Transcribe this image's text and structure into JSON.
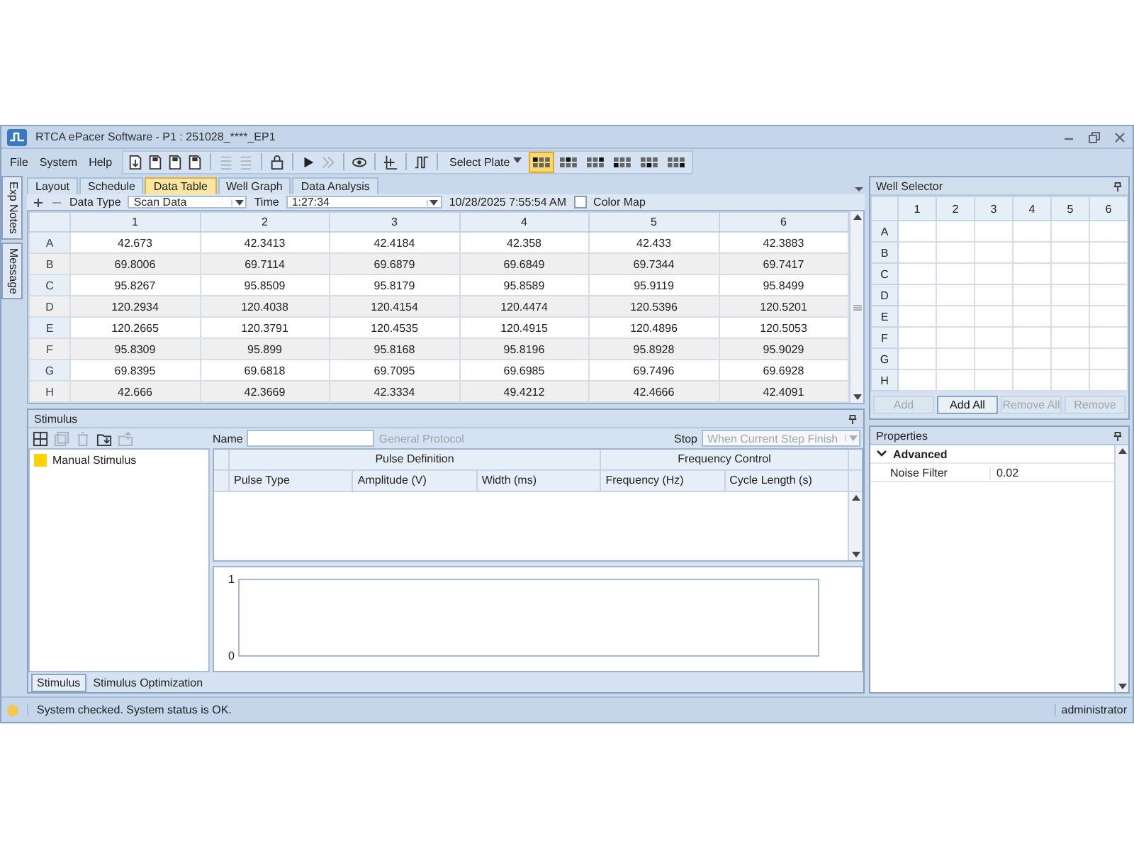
{
  "window": {
    "title": "RTCA ePacer Software - P1 : 251028_****_EP1"
  },
  "menu": [
    "File",
    "System",
    "Help"
  ],
  "toolbar": {
    "buttons": [
      {
        "disabled": false
      },
      {
        "disabled": false
      },
      {
        "disabled": false
      },
      {
        "disabled": false
      },
      {
        "disabled": true
      },
      {
        "disabled": true
      },
      {
        "disabled": false
      },
      {
        "disabled": false
      },
      {
        "disabled": true
      },
      {
        "disabled": false
      },
      {
        "disabled": false
      },
      {
        "disabled": false
      }
    ],
    "select_plate": "Select Plate",
    "layouts": [
      {
        "selected": true
      },
      {
        "selected": false
      },
      {
        "selected": false
      },
      {
        "selected": false
      },
      {
        "selected": false
      },
      {
        "selected": false
      }
    ]
  },
  "side_tabs": [
    "Exp Notes",
    "Message"
  ],
  "view_tabs": [
    {
      "label": "Layout",
      "selected": false
    },
    {
      "label": "Schedule",
      "selected": false
    },
    {
      "label": "Data Table",
      "selected": true
    },
    {
      "label": "Well Graph",
      "selected": false
    },
    {
      "label": "Data Analysis",
      "selected": false
    }
  ],
  "filters": {
    "data_type_label": "Data Type",
    "data_type": "Scan Data",
    "time_label": "Time",
    "time": "1:27:34",
    "timestamp": "10/28/2025 7:55:54 AM",
    "color_map": {
      "label": "Color Map",
      "checked": false
    }
  },
  "table": {
    "columns": [
      "1",
      "2",
      "3",
      "4",
      "5",
      "6"
    ],
    "rows": [
      {
        "label": "A",
        "cells": [
          "42.673",
          "42.3413",
          "42.4184",
          "42.358",
          "42.433",
          "42.3883"
        ]
      },
      {
        "label": "B",
        "cells": [
          "69.8006",
          "69.7114",
          "69.6879",
          "69.6849",
          "69.7344",
          "69.7417"
        ]
      },
      {
        "label": "C",
        "cells": [
          "95.8267",
          "95.8509",
          "95.8179",
          "95.8589",
          "95.9119",
          "95.8499"
        ]
      },
      {
        "label": "D",
        "cells": [
          "120.2934",
          "120.4038",
          "120.4154",
          "120.4474",
          "120.5396",
          "120.5201"
        ]
      },
      {
        "label": "E",
        "cells": [
          "120.2665",
          "120.3791",
          "120.4535",
          "120.4915",
          "120.4896",
          "120.5053"
        ]
      },
      {
        "label": "F",
        "cells": [
          "95.8309",
          "95.899",
          "95.8168",
          "95.8196",
          "95.8928",
          "95.9029"
        ]
      },
      {
        "label": "G",
        "cells": [
          "69.8395",
          "69.6818",
          "69.7095",
          "69.6985",
          "69.7496",
          "69.6928"
        ]
      },
      {
        "label": "H",
        "cells": [
          "42.666",
          "42.3669",
          "42.3334",
          "49.4212",
          "42.4666",
          "42.4091"
        ]
      }
    ]
  },
  "stimulus": {
    "title": "Stimulus",
    "tools": [
      {
        "disabled": false
      },
      {
        "disabled": true
      },
      {
        "disabled": true
      },
      {
        "disabled": false
      },
      {
        "disabled": true
      }
    ],
    "tree": [
      {
        "label": "Manual Stimulus",
        "color": "#ffd200"
      }
    ],
    "name_label": "Name",
    "protocol": "General Protocol",
    "stop_label": "Stop",
    "stop_placeholder": "When Current Step Finish",
    "groups": [
      {
        "label": "Pulse Definition",
        "columns": [
          "Pulse Type",
          "Amplitude (V)",
          "Width (ms)"
        ]
      },
      {
        "label": "Frequency Control",
        "columns": [
          "Frequency (Hz)",
          "Cycle Length (s)"
        ]
      }
    ],
    "plot": {
      "y_labels": [
        "1",
        "0"
      ]
    },
    "tabs": [
      {
        "label": "Stimulus",
        "selected": true
      },
      {
        "label": "Stimulus Optimization",
        "selected": false
      }
    ]
  },
  "well_selector": {
    "title": "Well Selector",
    "columns": [
      "1",
      "2",
      "3",
      "4",
      "5",
      "6"
    ],
    "rows": [
      "A",
      "B",
      "C",
      "D",
      "E",
      "F",
      "G",
      "H"
    ],
    "buttons": [
      {
        "label": "Add",
        "disabled": true
      },
      {
        "label": "Add All",
        "disabled": false
      },
      {
        "label": "Remove All",
        "disabled": true
      },
      {
        "label": "Remove",
        "disabled": true
      }
    ]
  },
  "properties": {
    "title": "Properties",
    "categories": [
      {
        "label": "Advanced",
        "expanded": true,
        "items": [
          {
            "name": "Noise Filter",
            "value": "0.02"
          }
        ]
      }
    ]
  },
  "status_bar": {
    "message": "System checked. System status is OK.",
    "user": "administrator"
  }
}
